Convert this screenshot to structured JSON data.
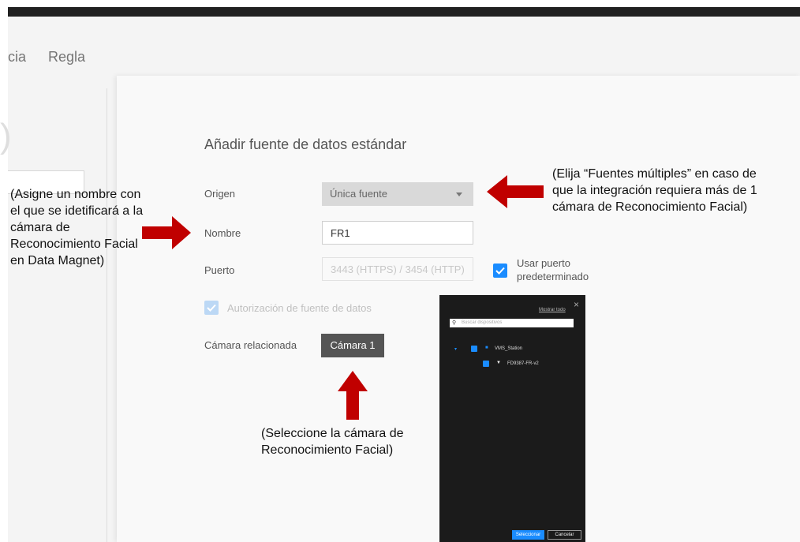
{
  "tabs": [
    "cia",
    "Regla"
  ],
  "left_panel": {
    "ghost_text": ")"
  },
  "dialog": {
    "title": "Añadir fuente de datos estándar",
    "origen": {
      "label": "Origen",
      "value": "Única fuente"
    },
    "nombre": {
      "label": "Nombre",
      "value": "FR1"
    },
    "puerto": {
      "label": "Puerto",
      "value": "3443 (HTTPS) / 3454 (HTTP)",
      "default_label_1": "Usar puerto",
      "default_label_2": "predeterminado",
      "default_checked": true
    },
    "autorizacion": {
      "label": "Autorización de fuente de datos",
      "checked": true
    },
    "camara": {
      "label": "Cámara relacionada",
      "button": "Cámara 1"
    }
  },
  "picker": {
    "show_all": "Mostrar todo",
    "close": "×",
    "search_placeholder": "Buscar dispositivos",
    "station": "VMS_Station",
    "device": "FD9387-FR-v2",
    "select_button": "Seleccionar",
    "cancel_button": "Cancelar"
  },
  "annotations": {
    "left": [
      "(Asigne un nombre con",
      "el que se idetificará a la",
      "cámara de",
      "Reconocimiento Facial",
      "en Data Magnet)"
    ],
    "right": [
      "(Elija “Fuentes múltiples” en caso de",
      "que la integración requiera más de 1",
      "cámara de Reconocimiento Facial)"
    ],
    "bottom": [
      "(Seleccione la cámara de",
      "Reconocimiento Facial)"
    ]
  },
  "colors": {
    "accent": "#1a8cff",
    "arrow": "#c00000"
  }
}
